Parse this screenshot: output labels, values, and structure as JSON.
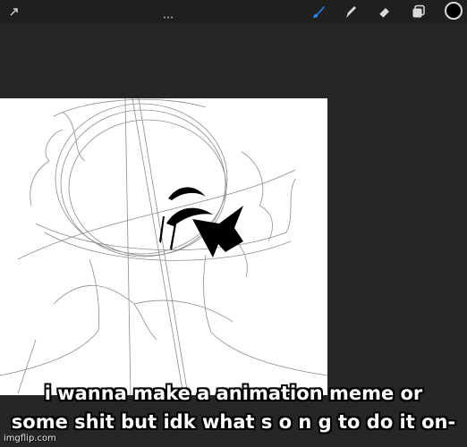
{
  "toolbar": {
    "tools": [
      {
        "icon": "actions-icon"
      },
      {
        "icon": "brush-icon",
        "active_color": "#1e8cff"
      },
      {
        "icon": "smudge-icon"
      },
      {
        "icon": "eraser-icon"
      },
      {
        "icon": "layers-icon"
      }
    ],
    "current_color": "#000000"
  },
  "canvas": {
    "background": "#ffffff",
    "content": "sketch-of-character-head"
  },
  "caption": {
    "line1": "i wanna make a animation meme or",
    "line2": "some shit but idk what s o n g to do it on-"
  },
  "watermark": "imgflip.com"
}
